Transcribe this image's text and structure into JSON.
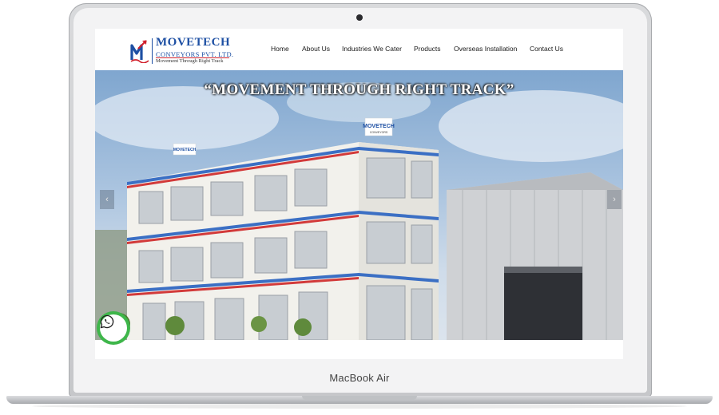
{
  "device": {
    "label": "MacBook Air"
  },
  "site": {
    "logo": {
      "name": "MOVETECH",
      "company": "CONVEYORS PVT. LTD.",
      "tagline": "Movement Through Right Track",
      "mark_letter": "M",
      "brand_blue": "#1d4fa3",
      "brand_red": "#d0202c"
    },
    "nav": [
      {
        "label": "Home"
      },
      {
        "label": "About Us"
      },
      {
        "label": "Industries We Cater"
      },
      {
        "label": "Products"
      },
      {
        "label": "Overseas Installation"
      },
      {
        "label": "Contact Us"
      }
    ],
    "hero": {
      "quote": "“MOVEMENT THROUGH RIGHT TRACK”",
      "building_sign": "MOVETECH",
      "building_sign_sub": "CONVEYORS",
      "prev_icon": "chevron-left-icon",
      "next_icon": "chevron-right-icon",
      "prev_glyph": "‹",
      "next_glyph": "›"
    },
    "whatsapp": {
      "icon": "whatsapp-icon",
      "color": "#3eb64a"
    }
  }
}
